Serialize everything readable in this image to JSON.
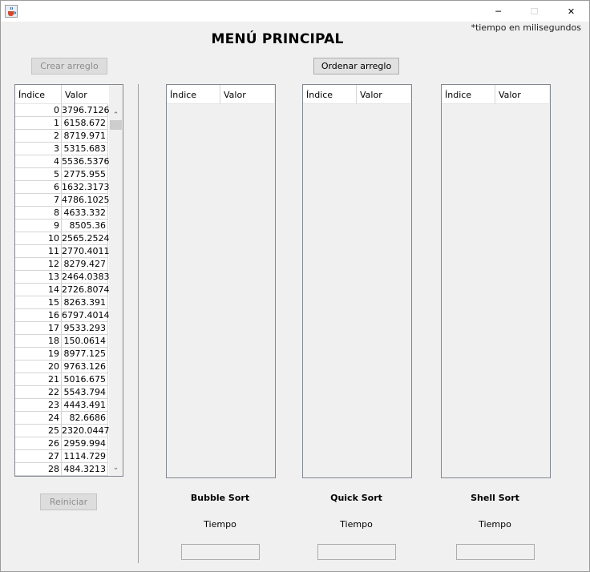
{
  "window": {
    "minimize_glyph": "─",
    "maximize_glyph": "☐",
    "close_glyph": "✕"
  },
  "note": "*tiempo en milisegundos",
  "main_title": "MENÚ PRINCIPAL",
  "buttons": {
    "create": "Crear arreglo",
    "order": "Ordenar arreglo",
    "reset": "Reiniciar"
  },
  "input_table": {
    "headers": [
      "Índice",
      "Valor"
    ],
    "rows": [
      [
        "0",
        "3796.7126"
      ],
      [
        "1",
        "6158.672"
      ],
      [
        "2",
        "8719.971"
      ],
      [
        "3",
        "5315.683"
      ],
      [
        "4",
        "5536.5376"
      ],
      [
        "5",
        "2775.955"
      ],
      [
        "6",
        "1632.3173"
      ],
      [
        "7",
        "4786.1025"
      ],
      [
        "8",
        "4633.332"
      ],
      [
        "9",
        "8505.36"
      ],
      [
        "10",
        "2565.2524"
      ],
      [
        "11",
        "2770.4011"
      ],
      [
        "12",
        "8279.427"
      ],
      [
        "13",
        "2464.0383"
      ],
      [
        "14",
        "2726.8074"
      ],
      [
        "15",
        "8263.391"
      ],
      [
        "16",
        "6797.4014"
      ],
      [
        "17",
        "9533.293"
      ],
      [
        "18",
        "150.0614"
      ],
      [
        "19",
        "8977.125"
      ],
      [
        "20",
        "9763.126"
      ],
      [
        "21",
        "5016.675"
      ],
      [
        "22",
        "5543.794"
      ],
      [
        "23",
        "4443.491"
      ],
      [
        "24",
        "82.6686"
      ],
      [
        "25",
        "2320.0447"
      ],
      [
        "26",
        "2959.994"
      ],
      [
        "27",
        "1114.729"
      ],
      [
        "28",
        "484.3213"
      ]
    ]
  },
  "algorithms": [
    {
      "name": "Bubble Sort",
      "time_label": "Tiempo",
      "headers": [
        "Índice",
        "Valor"
      ],
      "time_value": ""
    },
    {
      "name": "Quick Sort",
      "time_label": "Tiempo",
      "headers": [
        "Índice",
        "Valor"
      ],
      "time_value": ""
    },
    {
      "name": "Shell Sort",
      "time_label": "Tiempo",
      "headers": [
        "Índice",
        "Valor"
      ],
      "time_value": ""
    }
  ],
  "scrollbar": {
    "up": "⌃",
    "down": "⌄"
  }
}
